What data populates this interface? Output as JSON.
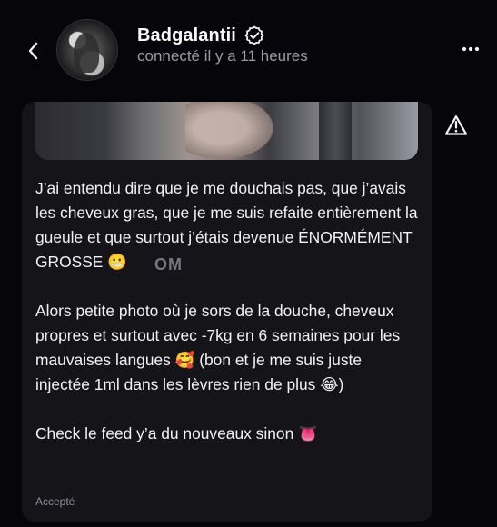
{
  "header": {
    "name": "Badgalantii",
    "status": "connecté il y a 11 heures"
  },
  "post": {
    "text": "J’ai entendu dire que je me douchais pas, que j’avais les cheveux gras, que je me suis refaite entièrement la gueule et que surtout j’étais devenue ÉNORMÉMENT GROSSE 😬\n\nAlors petite photo où je sors de la douche, cheveux propres et surtout avec -7kg en 6 semaines pour les mauvaises langues 🥰 (bon et je me suis juste injectée 1ml dans les lèvres rien de plus 😂)\n\nCheck le feed y’a du nouveaux sinon 👅",
    "accepted_label": "Accepté"
  },
  "watermark": "OM",
  "colors": {
    "background": "#06060a",
    "card": "#141419",
    "muted": "#9a9aa3",
    "text": "#f3f3f5"
  }
}
